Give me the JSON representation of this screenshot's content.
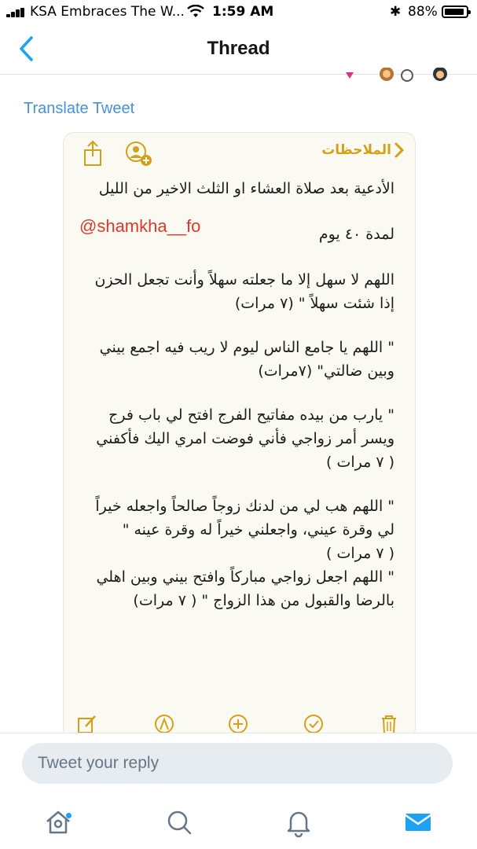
{
  "status_bar": {
    "carrier": "KSA Embraces The W...",
    "time": "1:59 AM",
    "battery": "88%"
  },
  "nav": {
    "title": "Thread"
  },
  "tweet": {
    "translate_label": "Translate Tweet",
    "image": {
      "back_label": "الملاحظات",
      "watermark": "@shamkha__fo",
      "lines": [
        "الأدعية بعد صلاة العشاء او الثلث الاخير من الليل",
        "لمدة ٤٠ يوم",
        "اللهم لا سهل إلا ما جعلته سهلاً وأنت تجعل الحزن",
        "إذا شئت سهلاً \"  (٧ مرات)",
        "\" اللهم يا جامع الناس ليوم لا ريب فيه اجمع بيني",
        "وبين ضالتي\"  (٧مرات)",
        "\" يارب من بيده مفاتيح الفرج افتح لي باب فرج",
        "ويسر أمر زواجي فأني فوضت امري اليك فأكفني",
        "( ٧ مرات )",
        "\" اللهم هب لي من لدنك زوجاً صالحاً واجعله خيراً",
        "لي وقرة عيني، واجعلني خيراً له وقرة عينه \"",
        "( ٧ مرات )",
        "\" اللهم اجعل زواجي مباركاً وافتح بيني وبين اهلي",
        "بالرضا والقبول من هذا الزواج \"  ( ٧ مرات)"
      ]
    }
  },
  "reply": {
    "placeholder": "Tweet your reply"
  },
  "colors": {
    "accent": "#1da1f2",
    "notes_yellow": "#d4a017",
    "watermark_red": "#d93a2b"
  },
  "tab_bar": {
    "items": [
      "home-icon",
      "search-icon",
      "bell-icon",
      "mail-icon"
    ],
    "active": "mail-icon"
  }
}
